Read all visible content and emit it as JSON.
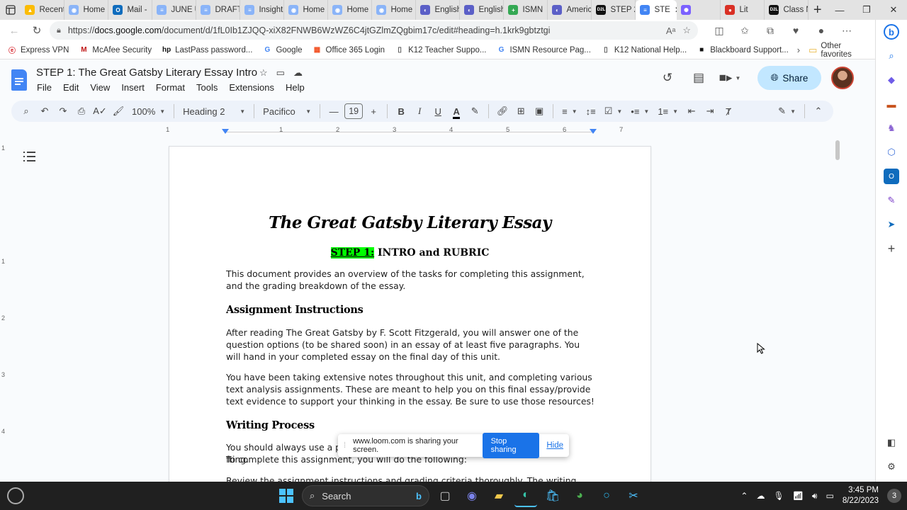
{
  "browser": {
    "tabs": [
      {
        "label": "Recent",
        "color": "#fbbc04",
        "glyph": "▲"
      },
      {
        "label": "Home",
        "color": "#8ab4f8",
        "glyph": "◉"
      },
      {
        "label": "Mail -",
        "color": "#0f6cbd",
        "glyph": "O"
      },
      {
        "label": "JUNE U",
        "color": "#8ab4f8",
        "glyph": "≡"
      },
      {
        "label": "DRAFT",
        "color": "#8ab4f8",
        "glyph": "≡"
      },
      {
        "label": "Insight",
        "color": "#8ab4f8",
        "glyph": "≡"
      },
      {
        "label": "Home",
        "color": "#8ab4f8",
        "glyph": "◉"
      },
      {
        "label": "Home",
        "color": "#8ab4f8",
        "glyph": "◉"
      },
      {
        "label": "Home",
        "color": "#8ab4f8",
        "glyph": "◉"
      },
      {
        "label": "English",
        "color": "#5b5fc7",
        "glyph": "◐"
      },
      {
        "label": "English",
        "color": "#5b5fc7",
        "glyph": "◐"
      },
      {
        "label": "ISMN",
        "color": "#34a853",
        "glyph": "+"
      },
      {
        "label": "Americ",
        "color": "#5b5fc7",
        "glyph": "◐"
      },
      {
        "label": "STEP 2",
        "color": "#111111",
        "glyph": "D2L"
      },
      {
        "label": "STE",
        "color": "#4285f4",
        "glyph": "≡",
        "active": true
      },
      {
        "label": "",
        "color": "#7b61ff",
        "glyph": "✺"
      },
      {
        "label": "Lit",
        "color": "#d93025",
        "glyph": "●"
      },
      {
        "label": "Class N",
        "color": "#111111",
        "glyph": "D2L"
      }
    ],
    "url_prefix": "https://",
    "url_host": "docs.google.com",
    "url_path": "/document/d/1fL0Ib1ZJQQ-xiX82FNWB6WzWZ6C4jtGZlmZQgbim17c/edit#heading=h.1krk9gbtztgi"
  },
  "bookmarks": [
    {
      "label": "Express VPN",
      "glyph": "ⓔ",
      "color": "#da3940"
    },
    {
      "label": "McAfee Security",
      "glyph": "M",
      "color": "#c01818"
    },
    {
      "label": "LastPass password...",
      "glyph": "hp",
      "color": "#111111"
    },
    {
      "label": "Google",
      "glyph": "G",
      "color": "#4285f4"
    },
    {
      "label": "Office 365 Login",
      "glyph": "▦",
      "color": "#f25022"
    },
    {
      "label": "K12 Teacher Suppo...",
      "glyph": "▯",
      "color": "#555555"
    },
    {
      "label": "ISMN Resource Pag...",
      "glyph": "G",
      "color": "#4285f4"
    },
    {
      "label": "K12 National Help...",
      "glyph": "▯",
      "color": "#555555"
    },
    {
      "label": "Blackboard Support...",
      "glyph": "■",
      "color": "#111111"
    }
  ],
  "bookmarks_other": "Other favorites",
  "docs": {
    "title": "STEP 1: The Great Gatsby Literary Essay Intro",
    "menu": [
      "File",
      "Edit",
      "View",
      "Insert",
      "Format",
      "Tools",
      "Extensions",
      "Help"
    ],
    "share_label": "Share"
  },
  "toolbar": {
    "zoom": "100%",
    "style": "Heading 2",
    "font": "Pacifico",
    "font_size": "19"
  },
  "ruler": [
    "1",
    "1",
    "2",
    "3",
    "4",
    "5",
    "6",
    "7"
  ],
  "vruler": [
    "1",
    "1",
    "2",
    "3",
    "4"
  ],
  "document": {
    "heading": "The Great Gatsby Literary Essay",
    "subheading_highlight": "STEP 1:",
    "subheading_rest": " INTRO and RUBRIC",
    "p1": "This document provides an overview of the tasks for completing this assignment, and the grading breakdown of the essay.",
    "sec1": "Assignment Instructions",
    "p2": "After reading The Great Gatsby by F. Scott Fitzgerald, you will answer one of the question options (to be shared soon) in an essay of at least five paragraphs. You will hand in your completed essay on the final day of this unit.",
    "p3": "You have been taking extensive notes throughout this unit, and completing various text analysis assignments. These are meant to help you on this final essay/provide text evidence to support your thinking in the essay. Be sure to use those resources!",
    "sec2": "Writing Process",
    "p4a": "You should always use a p",
    "p4b": "fting.",
    "p4c": "To complete this assignment, you will do the following:",
    "p5": "Review the assignment instructions and grading criteria thoroughly. The writing"
  },
  "loom": {
    "message": "www.loom.com is sharing your screen.",
    "stop_label": "Stop sharing",
    "hide_label": "Hide"
  },
  "taskbar": {
    "search_label": "Search",
    "time": "3:45 PM",
    "date": "8/22/2023",
    "notifications": "3"
  }
}
